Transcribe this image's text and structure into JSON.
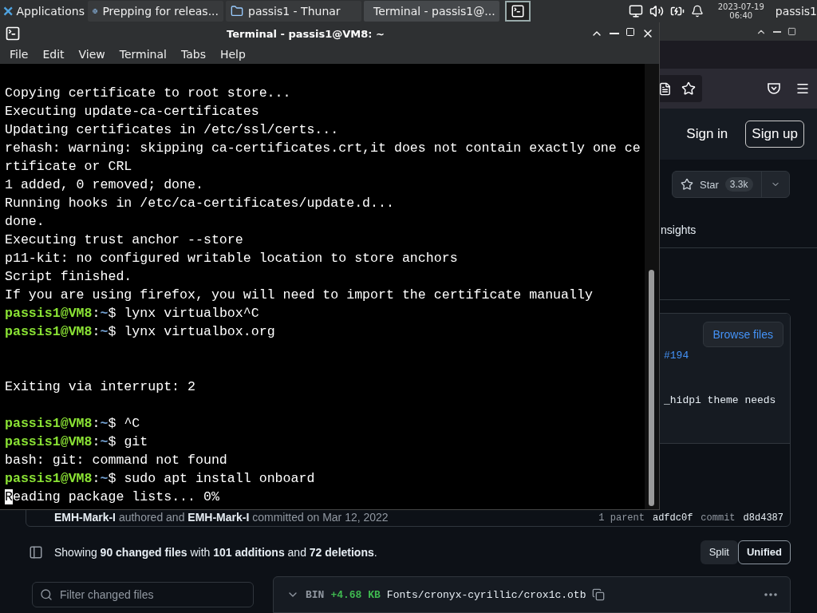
{
  "taskbar": {
    "apps_menu": "Applications",
    "tasks": [
      {
        "kind": "browser",
        "label": "Prepping for releas...",
        "selected": false
      },
      {
        "kind": "folder",
        "label": "passis1 - Thunar",
        "selected": false
      },
      {
        "kind": "terminal",
        "label": "Terminal - passis1@...",
        "selected": true
      }
    ],
    "clock": {
      "date": "2023-07-19",
      "time": "06:40"
    },
    "user": "passis1"
  },
  "terminal": {
    "title": "Terminal - passis1@VM8: ~",
    "menu": [
      "File",
      "Edit",
      "View",
      "Terminal",
      "Tabs",
      "Help"
    ],
    "lines": [
      {
        "kind": "blank"
      },
      {
        "kind": "output",
        "text": "Copying certificate to root store..."
      },
      {
        "kind": "output",
        "text": "Executing update-ca-certificates"
      },
      {
        "kind": "output",
        "text": "Updating certificates in /etc/ssl/certs..."
      },
      {
        "kind": "output",
        "text": "rehash: warning: skipping ca-certificates.crt,it does not contain exactly one ce"
      },
      {
        "kind": "output",
        "text": "rtificate or CRL"
      },
      {
        "kind": "output",
        "text": "1 added, 0 removed; done."
      },
      {
        "kind": "output",
        "text": "Running hooks in /etc/ca-certificates/update.d..."
      },
      {
        "kind": "output",
        "text": "done."
      },
      {
        "kind": "output",
        "text": "Executing trust anchor --store"
      },
      {
        "kind": "output",
        "text": "p11-kit: no configured writable location to store anchors"
      },
      {
        "kind": "output",
        "text": "Script finished."
      },
      {
        "kind": "output",
        "text": "If you are using firefox, you will need to import the certificate manually"
      },
      {
        "kind": "prompt",
        "user": "passis1@VM8",
        "sep": ":",
        "path": "~",
        "sign": "$",
        "command": "lynx virtualbox^C"
      },
      {
        "kind": "prompt",
        "user": "passis1@VM8",
        "sep": ":",
        "path": "~",
        "sign": "$",
        "command": "lynx virtualbox.org"
      },
      {
        "kind": "blank"
      },
      {
        "kind": "blank"
      },
      {
        "kind": "output",
        "text": "Exiting via interrupt: 2"
      },
      {
        "kind": "blank"
      },
      {
        "kind": "prompt",
        "user": "passis1@VM8",
        "sep": ":",
        "path": "~",
        "sign": "$",
        "command": "^C"
      },
      {
        "kind": "prompt",
        "user": "passis1@VM8",
        "sep": ":",
        "path": "~",
        "sign": "$",
        "command": "git"
      },
      {
        "kind": "output",
        "text": "bash: git: command not found"
      },
      {
        "kind": "prompt",
        "user": "passis1@VM8",
        "sep": ":",
        "path": "~",
        "sign": "$",
        "command": "sudo apt install onboard"
      },
      {
        "kind": "output",
        "text": "Reading package lists... 0%",
        "cursor": true
      }
    ]
  },
  "browser": {
    "header": {
      "sign_in": "Sign in",
      "sign_up": "Sign up"
    },
    "star": {
      "label": "Star",
      "count": "3.3k"
    },
    "tab_fragment": "nsights",
    "commit": {
      "browse": "Browse files",
      "pr_link": "#194",
      "message_fragment": "_hidpi theme needs",
      "byline": "**EMH-Mark-I** authored and **EMH-Mark-I** committed on Mar 12, 2022",
      "parent_label": "1 parent",
      "parent_sha": "adfdc0f",
      "commit_label": "commit",
      "commit_sha": "d8d4387"
    },
    "summary": "Showing **90 changed files** with **101 additions** and **72 deletions**.",
    "view_toggle": [
      {
        "label": "Split",
        "selected": false
      },
      {
        "label": "Unified",
        "selected": true
      }
    ],
    "filter": {
      "placeholder": "Filter changed files"
    },
    "file": {
      "type": "BIN",
      "size": "+4.68 KB",
      "path": "Fonts/cronyx-cyrillic/crox1c.otb"
    }
  }
}
